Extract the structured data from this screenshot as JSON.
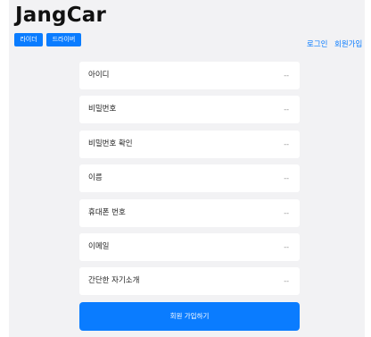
{
  "header": {
    "logo": "JangCar",
    "role_buttons": [
      "라이더",
      "드라이버"
    ],
    "auth_links": {
      "login": "로그인",
      "signup": "회원가입"
    }
  },
  "form": {
    "fields": [
      {
        "label": "아이디",
        "value": "--"
      },
      {
        "label": "비밀번호",
        "value": "--"
      },
      {
        "label": "비밀번호 확인",
        "value": "--"
      },
      {
        "label": "이름",
        "value": "--"
      },
      {
        "label": "휴대폰 번호",
        "value": "--"
      },
      {
        "label": "이메일",
        "value": "--"
      },
      {
        "label": "간단한 자기소개",
        "value": "--"
      }
    ],
    "submit_label": "회원 가입하기"
  },
  "colors": {
    "accent": "#0a7cff",
    "background": "#f2f2f4",
    "card": "#ffffff"
  }
}
